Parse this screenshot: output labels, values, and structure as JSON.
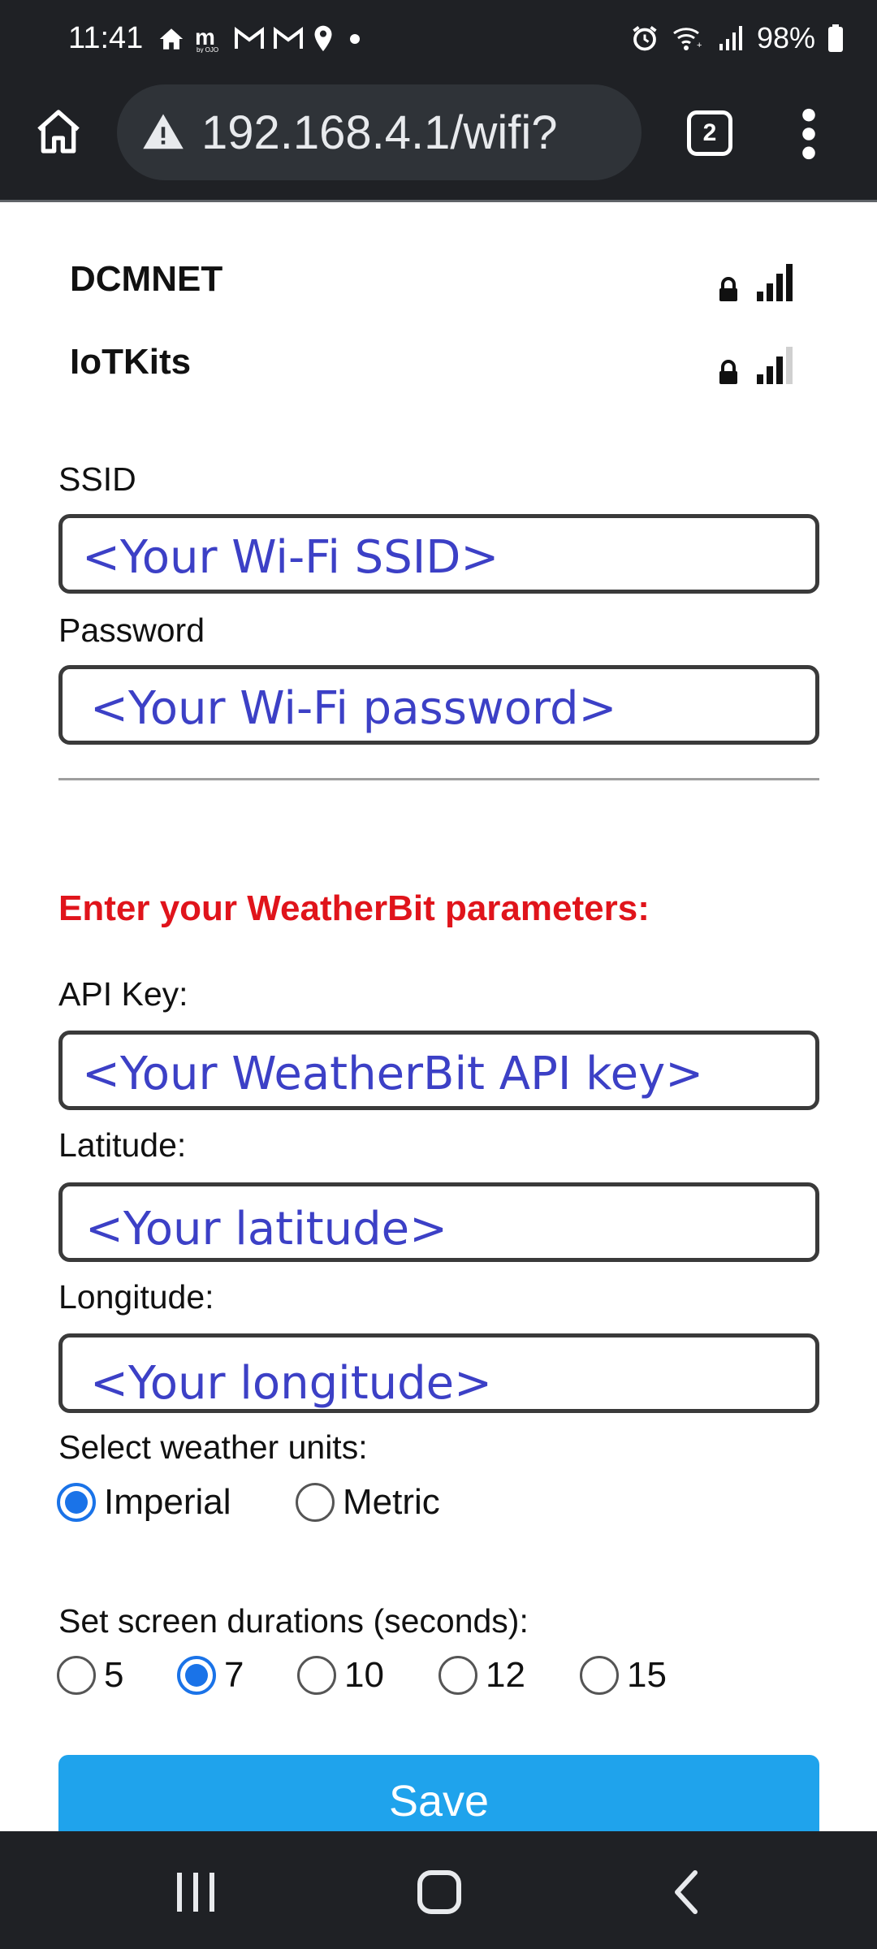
{
  "status_bar": {
    "time": "11:41",
    "battery_text": "98%",
    "icons_left": [
      "home-icon",
      "m-by-ojo-icon",
      "gmail-icon",
      "gmail-icon",
      "location-icon",
      "dot-icon"
    ],
    "icons_right": [
      "alarm-icon",
      "wifi-calling-icon",
      "cell-signal-icon",
      "battery-icon"
    ]
  },
  "browser": {
    "url": "192.168.4.1/wifi?",
    "tab_count": "2",
    "security": "not-secure-warning-icon"
  },
  "networks": [
    {
      "name": "DCMNET",
      "locked": true,
      "signal_bars": 4
    },
    {
      "name": "IoTKits",
      "locked": true,
      "signal_bars": 3
    }
  ],
  "wifi_form": {
    "ssid_label": "SSID",
    "ssid_placeholder": "<Your Wi-Fi SSID>",
    "password_label": "Password",
    "password_placeholder": "<Your Wi-Fi password>"
  },
  "weatherbit": {
    "section_title": "Enter your WeatherBit parameters:",
    "api_key_label": "API Key:",
    "api_key_placeholder": "<Your WeatherBit API key>",
    "latitude_label": "Latitude:",
    "latitude_placeholder": "<Your latitude>",
    "longitude_label": "Longitude:",
    "longitude_placeholder": "<Your longitude>",
    "units_label": "Select weather units:",
    "units_options": [
      {
        "label": "Imperial",
        "checked": true
      },
      {
        "label": "Metric",
        "checked": false
      }
    ],
    "duration_label": "Set screen durations (seconds):",
    "duration_options": [
      {
        "label": "5",
        "checked": false
      },
      {
        "label": "7",
        "checked": true
      },
      {
        "label": "10",
        "checked": false
      },
      {
        "label": "12",
        "checked": false
      },
      {
        "label": "15",
        "checked": false
      }
    ]
  },
  "save_label": "Save",
  "colors": {
    "accent": "#1a73e8",
    "button": "#1fa3ec",
    "section_title": "#e0141b",
    "placeholder_text": "#3c40c6",
    "chrome": "#1f2125"
  }
}
